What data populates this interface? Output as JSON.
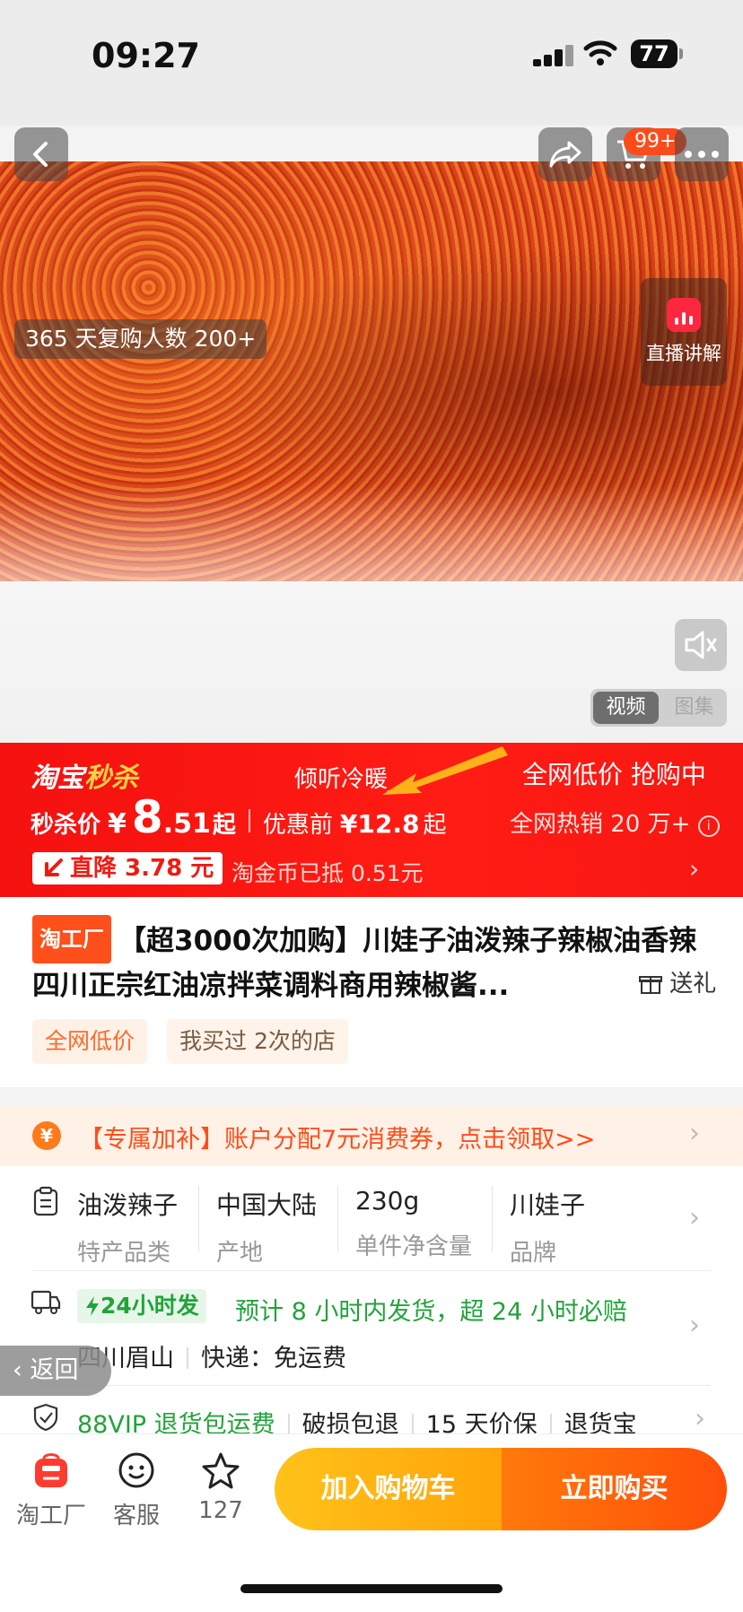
{
  "status_bar": {
    "time": "09:27",
    "battery": "77"
  },
  "header": {
    "cart_badge": "99+"
  },
  "hero": {
    "repurchase_tag": "365 天复购人数 200+",
    "live_label": "直播讲解"
  },
  "media_tabs": {
    "video": "视频",
    "gallery": "图集"
  },
  "promo": {
    "logo_main": "淘宝",
    "logo_accent": "秒杀",
    "ticker": "倾听冷暖_",
    "lowest_price": "全网低价 抢购中",
    "price_label": "秒杀价",
    "currency": "¥",
    "price_int": "8",
    "price_dec": ".51",
    "price_suffix": "起",
    "original_label": "优惠前",
    "original_price": "¥12.8",
    "original_suffix": "起",
    "hot_sales": "全网热销 20 万+",
    "drop_label": "直降 3.78 元",
    "coin_note": "淘金币已抵 0.51元"
  },
  "product": {
    "badge": "淘工厂",
    "title": "【超3000次加购】川娃子油泼辣子辣椒油香辣四川正宗红油凉拌菜调料商用辣椒酱...",
    "gift_label": "送礼",
    "pills": [
      "全网低价",
      "我买过 2次的店"
    ]
  },
  "subsidy": {
    "icon": "¥",
    "text": "【专属加补】账户分配7元消费券，点击领取>>"
  },
  "specs": [
    {
      "value": "油泼辣子",
      "label": "特产品类"
    },
    {
      "value": "中国大陆",
      "label": "产地"
    },
    {
      "value": "230g",
      "label": "单件净含量"
    },
    {
      "value": "川娃子",
      "label": "品牌"
    }
  ],
  "shipping": {
    "fast_badge": "24小时发",
    "fast_text": "预计 8 小时内发货，超 24 小时必赔",
    "origin": "四川眉山",
    "express": "快递：免运费"
  },
  "guarantees": {
    "vip": "88VIP 退货包运费",
    "items": [
      "破损包退",
      "15 天价保",
      "退货宝"
    ]
  },
  "back_button": "返回",
  "bottom_bar": {
    "shop_label": "淘工厂",
    "service_label": "客服",
    "fav_count": "127",
    "add_cart": "加入购物车",
    "buy_now": "立即购买"
  },
  "colors": {
    "promo_red": "#f4110f",
    "accent_orange": "#ff4f1a",
    "green": "#22a33a",
    "cart_yellow": "#ffb10f"
  }
}
